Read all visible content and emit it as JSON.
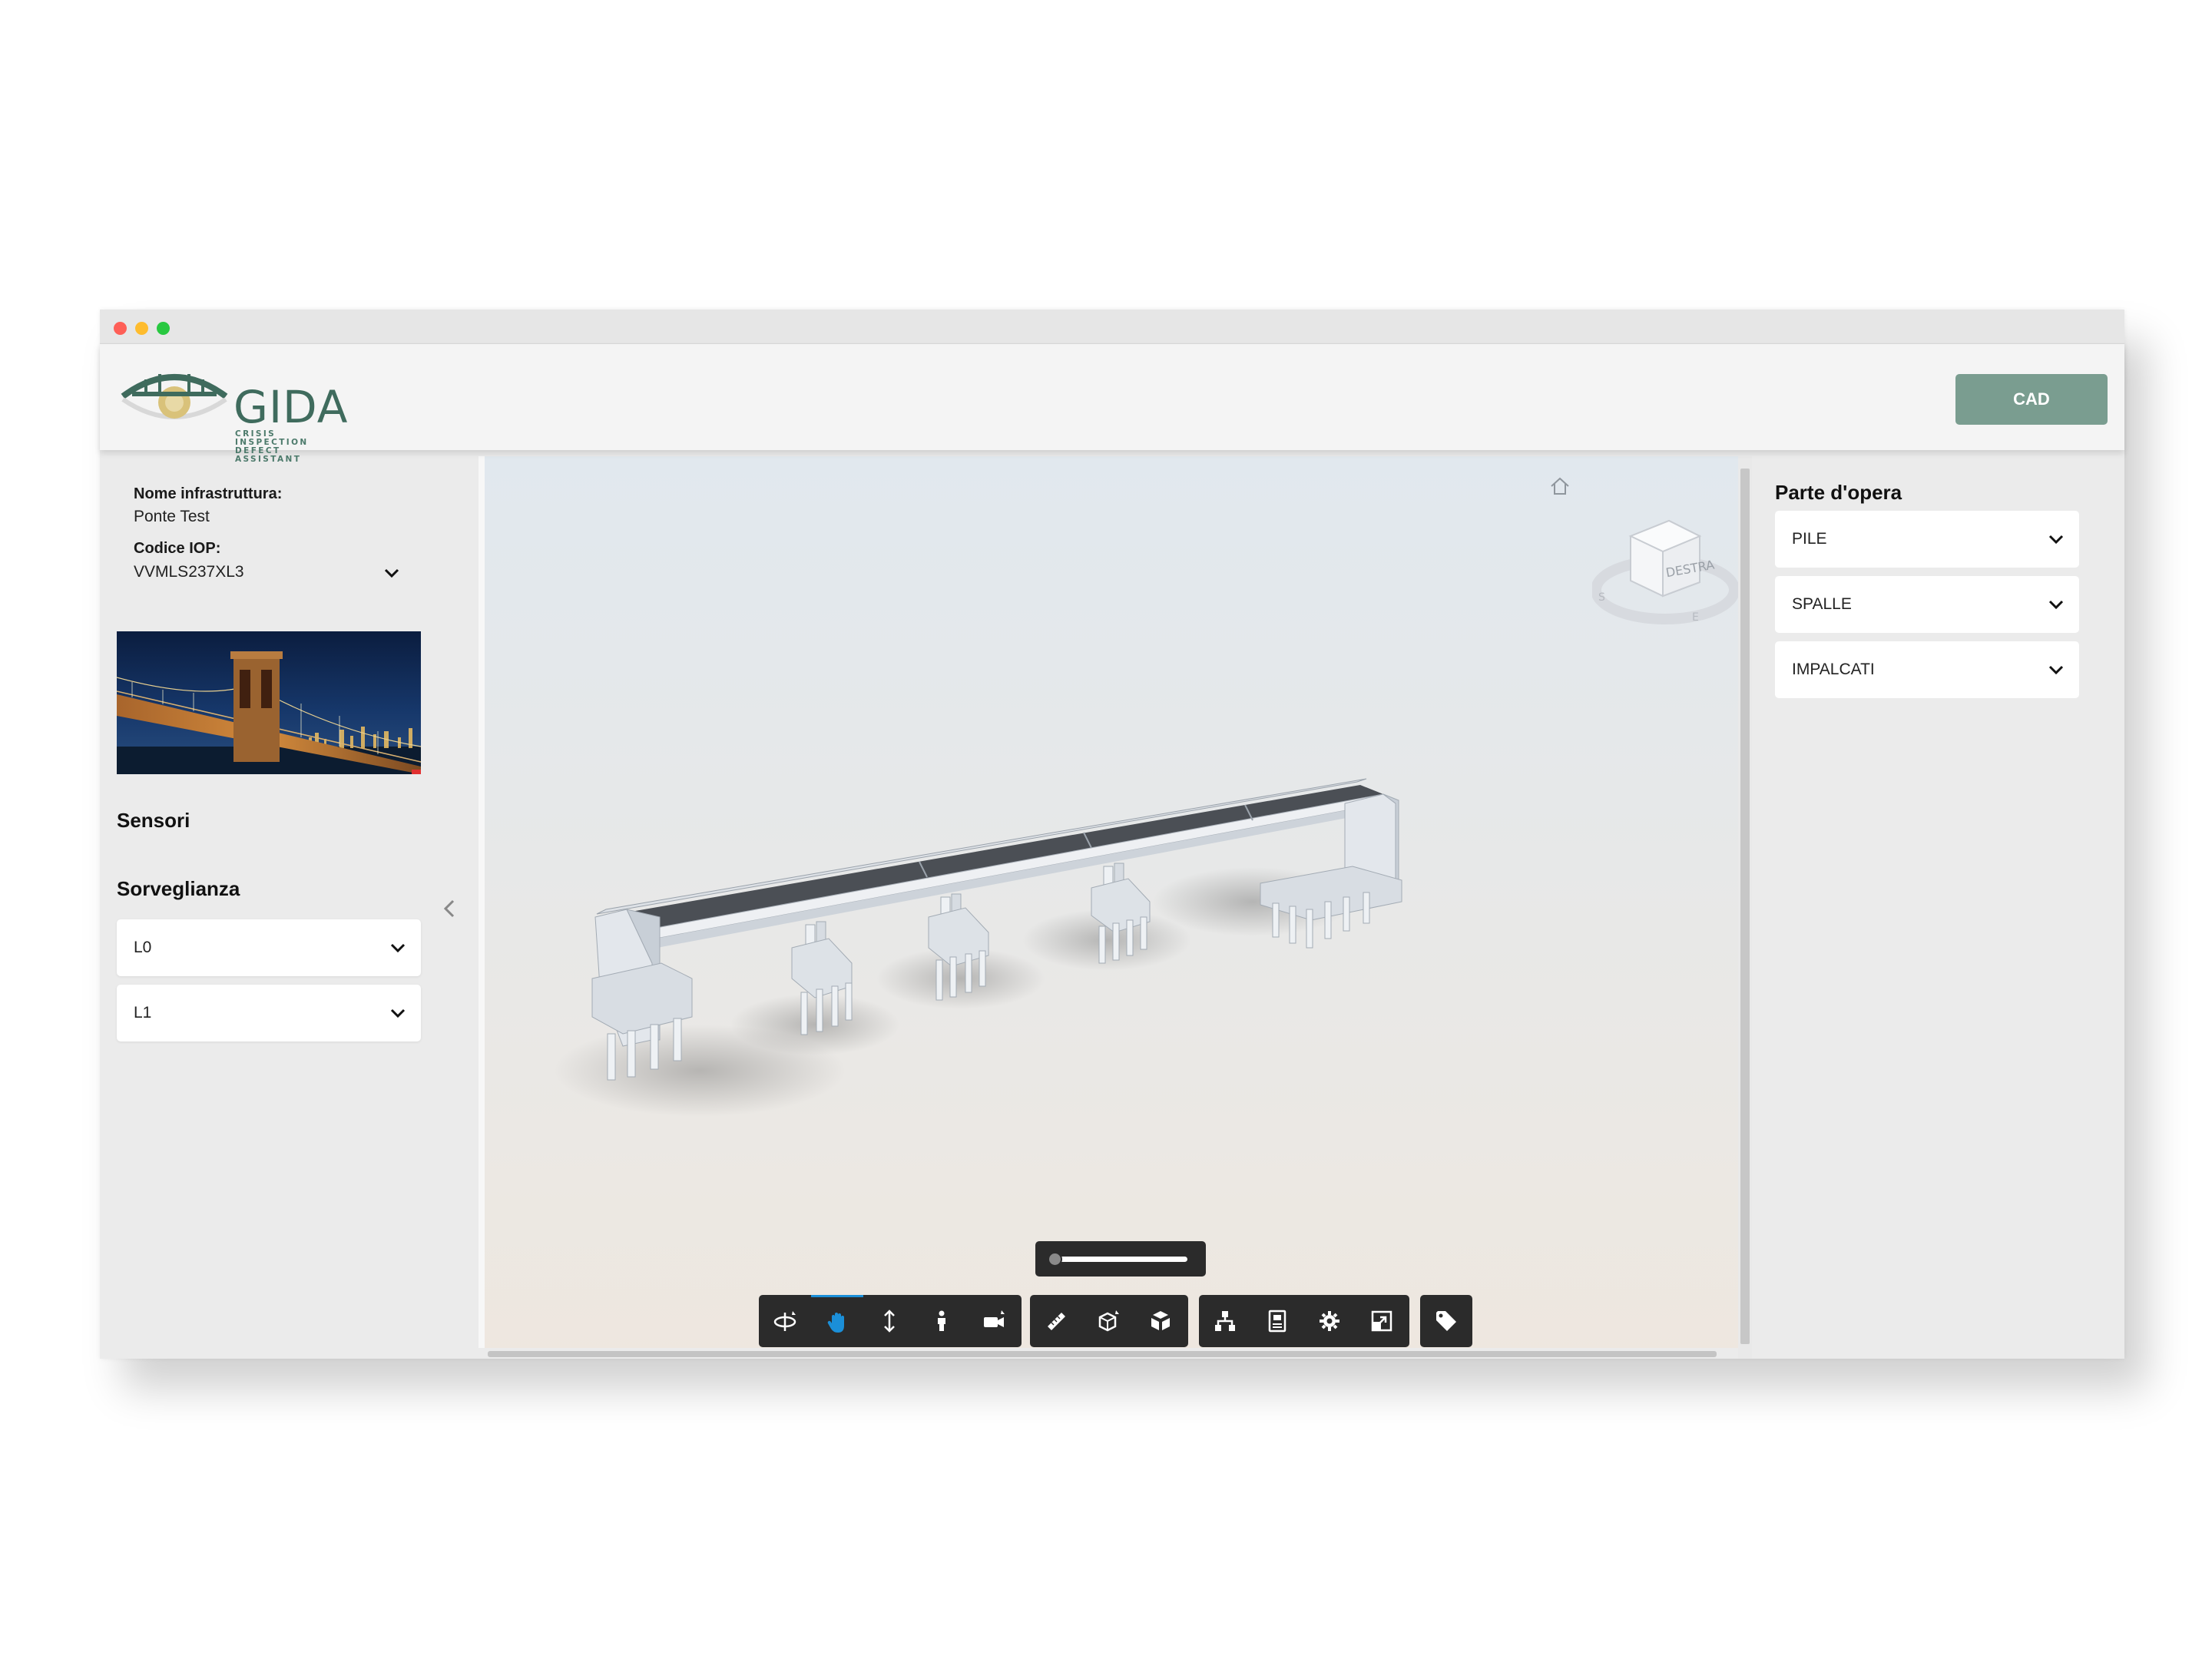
{
  "app": {
    "logo_text": "GIDA",
    "logo_subtitle_line1": "CRISIS INSPECTION",
    "logo_subtitle_line2": "DEFECT ASSISTANT",
    "cad_button": "CAD"
  },
  "infrastructure": {
    "name_label": "Nome infrastruttura:",
    "name_value": "Ponte Test",
    "code_label": "Codice IOP:",
    "code_value": "VVMLS237XL3"
  },
  "left_panel": {
    "sensors_title": "Sensori",
    "surveillance_title": "Sorveglianza",
    "levels": [
      {
        "label": "L0"
      },
      {
        "label": "L1"
      }
    ]
  },
  "right_panel": {
    "title": "Parte d'opera",
    "parts": [
      {
        "label": "PILE"
      },
      {
        "label": "SPALLE"
      },
      {
        "label": "IMPALCATI"
      }
    ]
  },
  "viewer": {
    "navcube_face": "DESTRA",
    "toolbar_icons": [
      "orbit-icon",
      "pan-icon",
      "zoom-icon",
      "first-person-icon",
      "camera-icon",
      "measure-icon",
      "section-icon",
      "explode-icon",
      "model-browser-icon",
      "properties-icon",
      "settings-icon",
      "fullscreen-icon",
      "tag-icon"
    ],
    "active_tool": "pan-icon",
    "accent_color": "#1b8fd8",
    "explode_slider_value": 0
  },
  "colors": {
    "brand": "#3f6b5d",
    "button": "#7a9d90",
    "toolbar": "#2b2b2b"
  }
}
